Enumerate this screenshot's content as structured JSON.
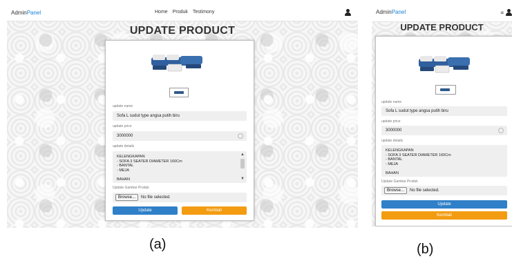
{
  "colors": {
    "accent": "#1a7fd6",
    "update_button": "#2f80c8",
    "back_button": "#f39c12",
    "field_bg": "#efefef"
  },
  "shot_a": {
    "brand_main": "Admin",
    "brand_accent": "Panel",
    "nav_links": [
      "Home",
      "Produk",
      "Testimony"
    ],
    "user_icon": "user-icon",
    "title": "UPDATE PRODUCT",
    "image_alt": "sofa-product-image",
    "name_label": "update name",
    "name_value": "Sofa L sudut type angsa putih biru",
    "price_label": "update price",
    "price_value": "3000000",
    "details_label": "update details",
    "details_lines": [
      "KELENGKAPAN",
      "- SOFA 3 SEATER DIAMETER 160Cm",
      "- BANTAL",
      "- MEJA",
      "",
      "BAHAN"
    ],
    "file_label": "Update Gambar Produk",
    "browse_label": "Browse...",
    "file_status": "No file selected.",
    "update_label": "Update",
    "back_label": "Kembali",
    "caption": "(a)"
  },
  "shot_b": {
    "brand_main": "Admin",
    "brand_accent": "Panel",
    "menu_icon": "hamburger-icon",
    "user_icon": "user-icon",
    "title": "UPDATE PRODUCT",
    "name_label": "update name",
    "name_value": "Sofa L sudut type angsa putih biru",
    "price_label": "update price",
    "price_value": "3000000",
    "details_label": "update details",
    "details_lines": [
      "KELENGKAPAN",
      "- SOFA 3 SEATER DIAMETER 160Cm",
      "- BANTAL",
      "- MEJA",
      "",
      "BAHAN"
    ],
    "file_label": "Update Gambar Produk",
    "browse_label": "Browse...",
    "file_status": "No file selected.",
    "update_label": "Update",
    "back_label": "Kembali",
    "caption": "(b)"
  }
}
